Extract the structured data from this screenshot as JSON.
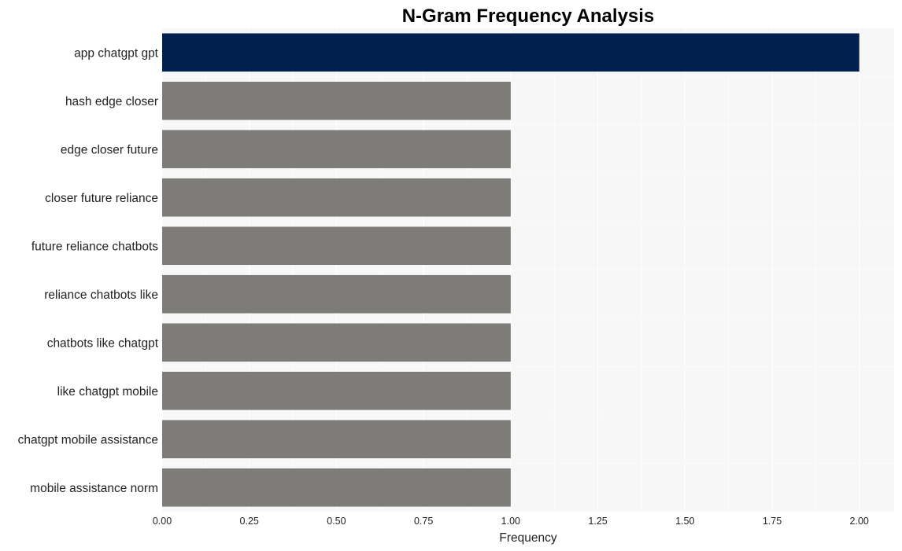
{
  "chart_data": {
    "type": "bar",
    "orientation": "horizontal",
    "title": "N-Gram Frequency Analysis",
    "xlabel": "Frequency",
    "ylabel": "",
    "xlim": [
      0,
      2.1
    ],
    "xticks": [
      "0.00",
      "0.25",
      "0.50",
      "0.75",
      "1.00",
      "1.25",
      "1.50",
      "1.75",
      "2.00"
    ],
    "xtick_values": [
      0,
      0.25,
      0.5,
      0.75,
      1.0,
      1.25,
      1.5,
      1.75,
      2.0
    ],
    "grid": true,
    "categories": [
      "app chatgpt gpt",
      "hash edge closer",
      "edge closer future",
      "closer future reliance",
      "future reliance chatbots",
      "reliance chatbots like",
      "chatbots like chatgpt",
      "like chatgpt mobile",
      "chatgpt mobile assistance",
      "mobile assistance norm"
    ],
    "values": [
      2,
      1,
      1,
      1,
      1,
      1,
      1,
      1,
      1,
      1
    ],
    "colors": {
      "highlight": "#00214d",
      "default": "#7d7c78",
      "plot_background": "#f7f7f7",
      "grid": "#ffffff"
    }
  }
}
